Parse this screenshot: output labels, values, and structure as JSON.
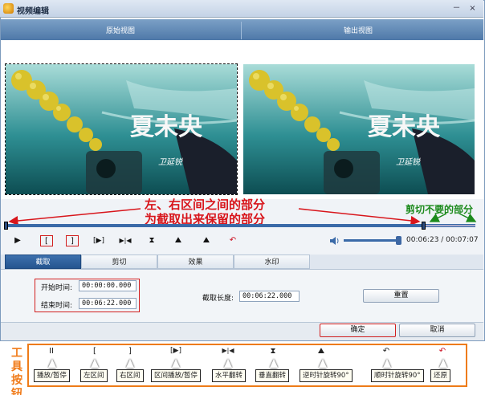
{
  "window": {
    "title": "视频编辑",
    "minimize": "－",
    "close": "×"
  },
  "views": {
    "source_label": "原始视图",
    "output_label": "输出视图"
  },
  "video": {
    "overlay_text": "夏未央",
    "overlay_signature": "卫延锐"
  },
  "annotations": {
    "keep_line1": "左、右区间之间的部分",
    "keep_line2": "为截取出来保留的部分",
    "cut_unwanted": "剪切不要的部分"
  },
  "toolbar": {
    "play": "▶",
    "left_interval": "[",
    "right_interval": "]",
    "interval_play": "[▶]",
    "flip_horizontal": "▶|◀",
    "flip_vertical": "⧗",
    "rotate_ccw": "⛰",
    "rotate_cw": "⛰",
    "restore": "↶",
    "time_display": "00:06:23 / 00:07:07",
    "volume_level": 0.95
  },
  "tabs": [
    "截取",
    "剪切",
    "效果",
    "水印"
  ],
  "active_tab": 0,
  "trim": {
    "start_label": "开始时间:",
    "start_value": "00:00:00.000",
    "end_label": "结束时间:",
    "end_value": "00:06:22.000",
    "length_label": "截取长度:",
    "length_value": "00:06:22.000",
    "reset_label": "重置"
  },
  "footer": {
    "ok_label": "确定",
    "cancel_label": "取消"
  },
  "legend": {
    "title": "工具按钮",
    "items": [
      {
        "icon": "II",
        "label": "播放/暂停"
      },
      {
        "icon": "[",
        "label": "左区间"
      },
      {
        "icon": "]",
        "label": "右区间"
      },
      {
        "icon": "[▶]",
        "label": "区间播放/暂停"
      },
      {
        "icon": "▶|◀",
        "label": "水平翻转"
      },
      {
        "icon": "⧗",
        "label": "垂直翻转"
      },
      {
        "icon": "⛰",
        "label": "逆时针旋转90°"
      },
      {
        "icon": "↶",
        "label": "顺时针旋转90°"
      },
      {
        "icon": "↶",
        "label": "还原"
      }
    ]
  },
  "colors": {
    "accent": "#2b5c99",
    "annotation_red": "#d8151b",
    "annotation_green": "#1c8a1c",
    "legend_border": "#ee7b18"
  }
}
